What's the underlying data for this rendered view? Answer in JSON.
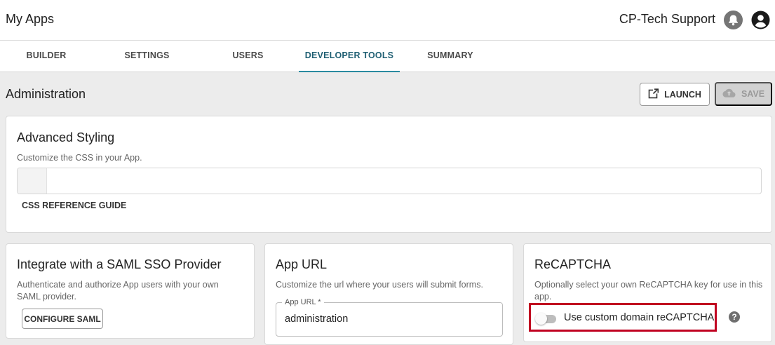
{
  "header": {
    "app_title": "My Apps",
    "org_name": "CP-Tech Support",
    "icons": [
      "bell-icon",
      "account-icon"
    ]
  },
  "tabs": [
    {
      "label": "BUILDER",
      "active": false
    },
    {
      "label": "SETTINGS",
      "active": false
    },
    {
      "label": "USERS",
      "active": false
    },
    {
      "label": "DEVELOPER TOOLS",
      "active": true
    },
    {
      "label": "SUMMARY",
      "active": false
    }
  ],
  "page": {
    "title": "Administration",
    "launch_label": "LAUNCH",
    "save_label": "SAVE"
  },
  "advanced_styling": {
    "title": "Advanced Styling",
    "description": "Customize the CSS in your App.",
    "css_value": "",
    "link_label": "CSS REFERENCE GUIDE"
  },
  "saml": {
    "title": "Integrate with a SAML SSO Provider",
    "description": "Authenticate and authorize App users with your own SAML provider.",
    "button_label": "CONFIGURE SAML"
  },
  "app_url": {
    "title": "App URL",
    "description": "Customize the url where your users will submit forms.",
    "field_label": "App URL *",
    "field_value": "administration"
  },
  "recaptcha": {
    "title": "ReCAPTCHA",
    "description": "Optionally select your own ReCAPTCHA key for use in this app.",
    "toggle_label": "Use custom domain reCAPTCHA",
    "toggle_on": false,
    "help_glyph": "?"
  },
  "colors": {
    "accent": "#2a8aa0",
    "highlight": "#c00020"
  }
}
